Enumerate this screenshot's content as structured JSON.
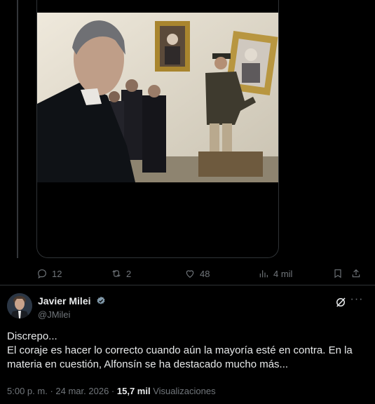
{
  "previous_tweet": {
    "media_alt": "photo",
    "stats": {
      "replies": "12",
      "reposts": "2",
      "likes": "48",
      "views": "4 mil"
    }
  },
  "tweet": {
    "author": {
      "display_name": "Javier Milei",
      "handle": "@JMilei",
      "verified": true
    },
    "text_lines": [
      "Discrepo...",
      "El coraje es hacer lo correcto cuando aún la mayoría esté en contra. En la materia en cuestión, Alfonsín se ha destacado mucho más..."
    ],
    "time": "5:00 p. m.",
    "separator": "·",
    "date": "24 mar. 2026",
    "views_count": "15,7 mil",
    "views_label": "Visualizaciones"
  },
  "colors": {
    "background": "#000000",
    "text": "#e7e9ea",
    "muted": "#71767b",
    "border": "#2f3336",
    "verified": "#829aab"
  },
  "icons": [
    "reply-icon",
    "repost-icon",
    "like-icon",
    "views-icon",
    "bookmark-icon",
    "share-icon",
    "verified-badge-icon",
    "grok-icon",
    "more-icon"
  ]
}
